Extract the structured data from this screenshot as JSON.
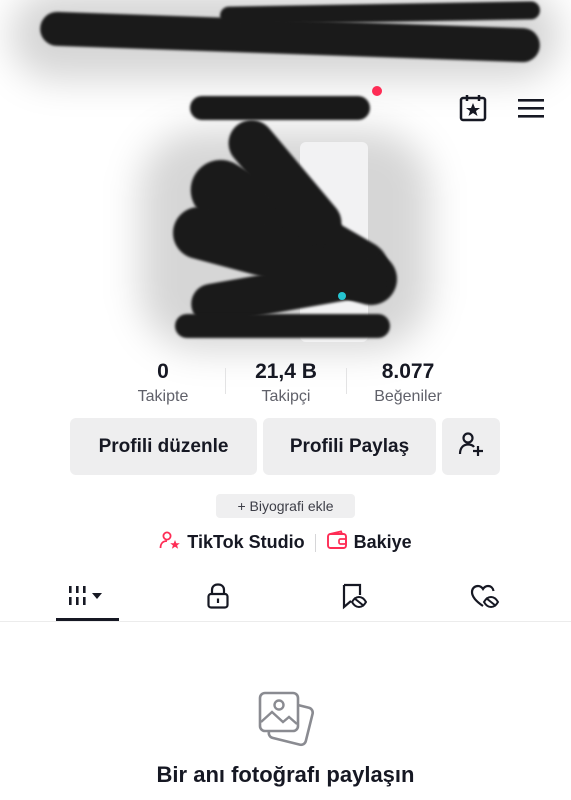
{
  "stats": [
    {
      "value": "0",
      "label": "Takipte"
    },
    {
      "value": "21,4 B",
      "label": "Takipçi"
    },
    {
      "value": "8.077",
      "label": "Beğeniler"
    }
  ],
  "actions": {
    "edit_profile": "Profili düzenle",
    "share_profile": "Profili Paylaş"
  },
  "bio_button": "+ Biyografi ekle",
  "links": {
    "studio": "TikTok Studio",
    "balance": "Bakiye"
  },
  "tabs": [
    {
      "icon": "grid-icon"
    },
    {
      "icon": "lock-icon"
    },
    {
      "icon": "tagged-icon"
    },
    {
      "icon": "liked-icon"
    }
  ],
  "empty_state": {
    "title": "Bir anı fotoğrafı paylaşın"
  },
  "colors": {
    "accent": "#fe2c55",
    "text": "#161823",
    "muted": "#60616a",
    "button_bg": "#eeeeef"
  }
}
